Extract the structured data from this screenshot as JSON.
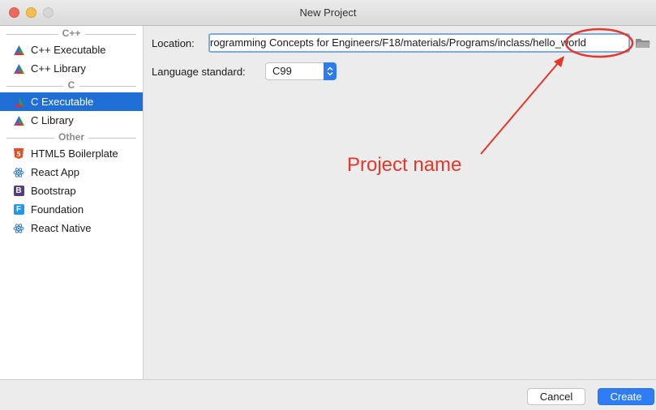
{
  "window": {
    "title": "New Project"
  },
  "sidebar": {
    "groups": [
      {
        "label": "C++",
        "items": [
          {
            "label": "C++ Executable",
            "icon": "cmake-icon"
          },
          {
            "label": "C++ Library",
            "icon": "cmake-icon"
          }
        ]
      },
      {
        "label": "C",
        "items": [
          {
            "label": "C Executable",
            "icon": "cmake-icon",
            "selected": true
          },
          {
            "label": "C Library",
            "icon": "cmake-icon"
          }
        ]
      },
      {
        "label": "Other",
        "items": [
          {
            "label": "HTML5 Boilerplate",
            "icon": "html5-icon"
          },
          {
            "label": "React App",
            "icon": "react-icon"
          },
          {
            "label": "Bootstrap",
            "icon": "bootstrap-icon"
          },
          {
            "label": "Foundation",
            "icon": "foundation-icon"
          },
          {
            "label": "React Native",
            "icon": "react-icon"
          }
        ]
      }
    ]
  },
  "form": {
    "location_label": "Location:",
    "location_value": "rogramming Concepts for Engineers/F18/materials/Programs/inclass/hello_world",
    "language_label": "Language standard:",
    "language_value": "C99"
  },
  "annotation": {
    "text": "Project name",
    "color": "#e4372a"
  },
  "footer": {
    "cancel_label": "Cancel",
    "create_label": "Create"
  },
  "colors": {
    "accent": "#1f6fd6",
    "html5": "#e44d26",
    "bootstrap": "#563d7c",
    "foundation": "#2199e8",
    "react": "#3b7fc4"
  }
}
